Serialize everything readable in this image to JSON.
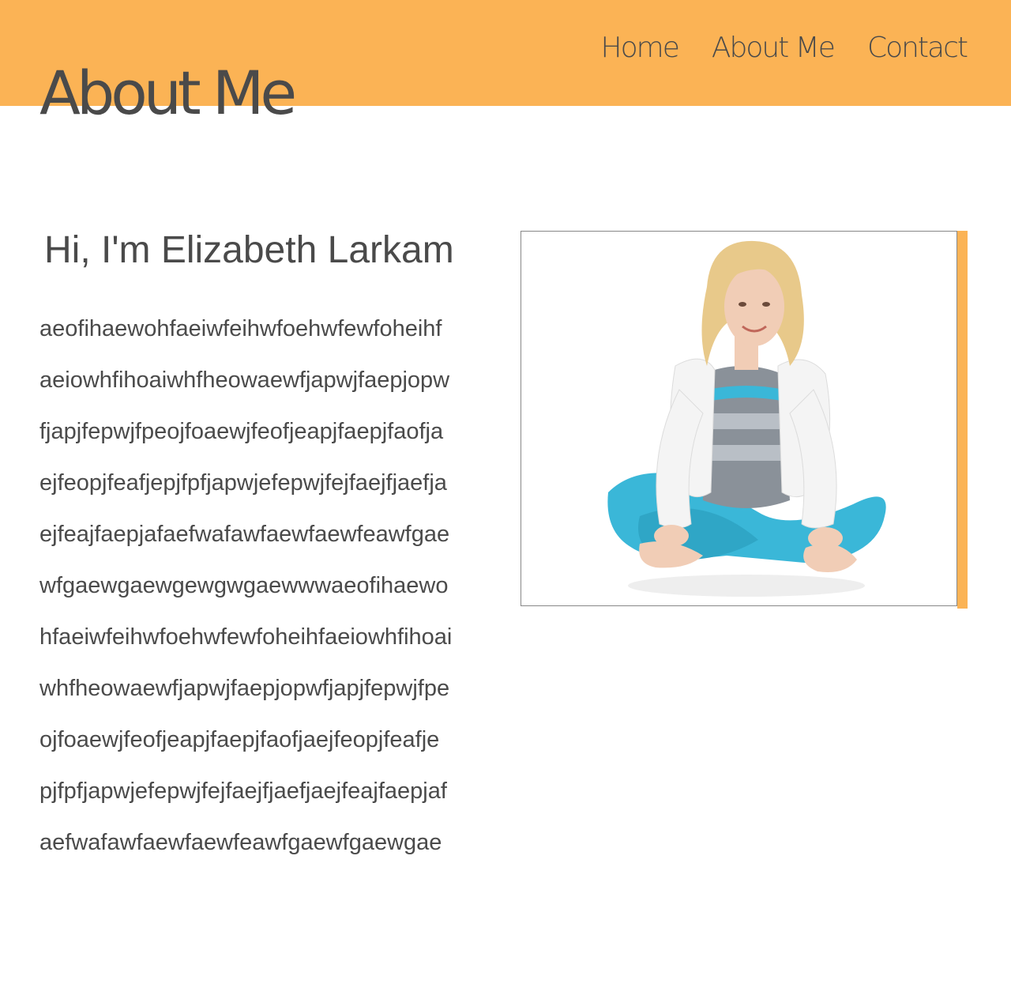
{
  "header": {
    "nav": [
      {
        "label": "Home"
      },
      {
        "label": "About Me"
      },
      {
        "label": "Contact"
      }
    ]
  },
  "page": {
    "title": "About Me"
  },
  "intro": {
    "heading": "Hi, I'm Elizabeth Larkam",
    "bio_lines": [
      "aeofihaewohfaeiwfeihwfoehwfewfoheihf",
      "aeiowhfihoaiwhfheowaewfjapwjfaepjopw",
      "fjapjfepwjfpeojfoaewjfeofjeapjfaepjfaofja",
      "ejfeopjfeafjepjfpfjapwjefepwjfejfaejfjaefja",
      "ejfeajfaepjafaefwafawfaewfaewfeawfgae",
      "wfgaewgaewgewgwgaewwwaeofihaewo",
      "hfaeiwfeihwfoehwfewfoheihfaeiowhfihoai",
      "whfheowaewfjapwjfaepjopwfjapjfepwjfpe",
      "ojfoaewjfeofjeapjfaepjfaofjaejfeopjfeafje",
      "pjfpfjapwjefepwjfejfaejfjaefjaejfeajfaepjaf",
      "aefwafawfaewfaewfeawfgaewfgaewgae"
    ]
  },
  "photo": {
    "accent_color": "#fbb355",
    "top_color": "#ffffff",
    "pants_color": "#3ab7d8",
    "jacket_color": "#f4f4f4",
    "hair_color": "#e8c98a",
    "skin_color": "#f1cdb6"
  }
}
